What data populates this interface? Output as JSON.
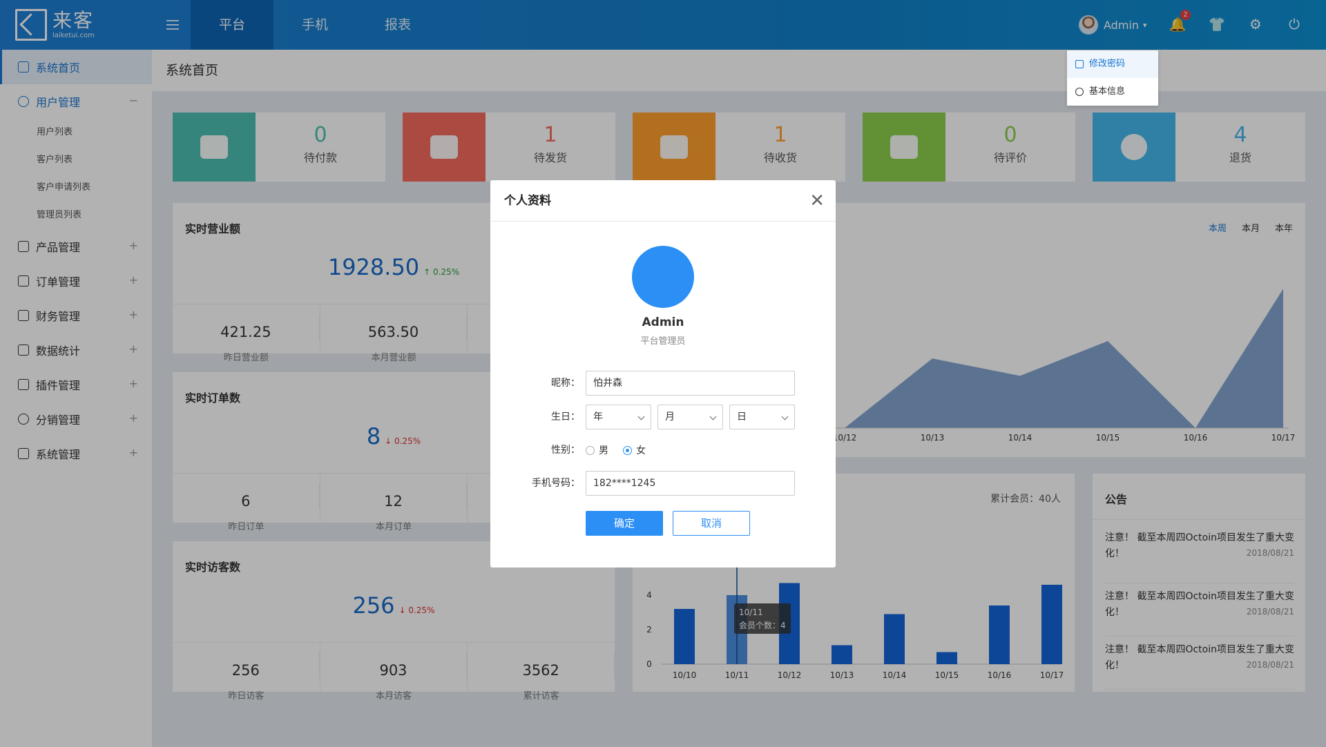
{
  "brand": {
    "cn": "来客",
    "en": "laiketui.com"
  },
  "nav": [
    "平台",
    "手机",
    "报表"
  ],
  "user": {
    "name": "Admin",
    "notifications": "2"
  },
  "dropdown": [
    "修改密码",
    "基本信息"
  ],
  "sidebar": {
    "items": [
      {
        "label": "系统首页",
        "state": "active"
      },
      {
        "label": "用户管理",
        "state": "open",
        "toggle": "−"
      },
      {
        "label": "产品管理",
        "toggle": "+"
      },
      {
        "label": "订单管理",
        "toggle": "+"
      },
      {
        "label": "财务管理",
        "toggle": "+"
      },
      {
        "label": "数据统计",
        "toggle": "+"
      },
      {
        "label": "插件管理",
        "toggle": "+"
      },
      {
        "label": "分销管理",
        "toggle": "+"
      },
      {
        "label": "系统管理",
        "toggle": "+"
      }
    ],
    "sub_items": [
      "用户列表",
      "客户列表",
      "客户申请列表",
      "管理员列表"
    ]
  },
  "breadcrumb": "系统首页",
  "stats": [
    {
      "value": "0",
      "label": "待付款",
      "color": "#4ebfb3"
    },
    {
      "value": "1",
      "label": "待发货",
      "color": "#f46a5e"
    },
    {
      "value": "1",
      "label": "待收货",
      "color": "#ff9f2e"
    },
    {
      "value": "0",
      "label": "待评价",
      "color": "#8ccf4d"
    },
    {
      "value": "4",
      "label": "退货",
      "color": "#46b6ec"
    }
  ],
  "cards": {
    "revenue": {
      "title": "实时营业额",
      "value": "1928.50",
      "trend": "↑ 0.25%",
      "subs": [
        {
          "n": "421.25",
          "l": "昨日营业额"
        },
        {
          "n": "563.50",
          "l": "本月营业额"
        }
      ]
    },
    "orders": {
      "title": "实时订单数",
      "value": "8",
      "trend": "↓ 0.25%",
      "subs": [
        {
          "n": "6",
          "l": "昨日订单"
        },
        {
          "n": "12",
          "l": "本月订单"
        }
      ]
    },
    "visitors": {
      "title": "实时访客数",
      "value": "256",
      "trend": "↓ 0.25%",
      "subs": [
        {
          "n": "256",
          "l": "昨日访客"
        },
        {
          "n": "903",
          "l": "本月访客"
        },
        {
          "n": "3562",
          "l": "累计访客"
        }
      ]
    }
  },
  "chart_tabs": [
    "本周",
    "本月",
    "本年"
  ],
  "member_total": "累计会员：40人",
  "notice": {
    "title": "公告",
    "items": [
      {
        "text": "注意！ 截至本周四Octoin项目发生了重大变化！",
        "date": "2018/08/21"
      },
      {
        "text": "注意！ 截至本周四Octoin项目发生了重大变化！",
        "date": "2018/08/21"
      },
      {
        "text": "注意！ 截至本周四Octoin项目发生了重大变化！",
        "date": "2018/08/21"
      }
    ]
  },
  "chart_data": [
    {
      "type": "area",
      "x": [
        "10/12",
        "10/13",
        "10/14",
        "10/15",
        "10/16",
        "10/17"
      ],
      "values": [
        0,
        2.4,
        1.8,
        3.0,
        0,
        4.8
      ],
      "color": "#6d95c8"
    },
    {
      "type": "bar",
      "categories": [
        "10/10",
        "10/11",
        "10/12",
        "10/13",
        "10/14",
        "10/15",
        "10/16",
        "10/17"
      ],
      "values": [
        3.2,
        4,
        4.7,
        1.1,
        2.9,
        0.7,
        3.4,
        4.6
      ],
      "y_ticks": [
        "0",
        "2",
        "4"
      ],
      "ylim": [
        0,
        5
      ],
      "tooltip": {
        "title": "10/11",
        "text": "会员个数：4"
      },
      "color": "#1565d8",
      "highlight": "#4d8fe0"
    }
  ],
  "modal": {
    "title": "个人资料",
    "name": "Admin",
    "role": "平台管理员",
    "nickname_label": "昵称：",
    "nickname": "怕井森",
    "birthday_label": "生日：",
    "birthday": [
      "年",
      "月",
      "日"
    ],
    "gender_label": "性别：",
    "gender_options": [
      "男",
      "女"
    ],
    "phone_label": "手机号码：",
    "phone": "182****1245",
    "ok": "确定",
    "cancel": "取消"
  }
}
